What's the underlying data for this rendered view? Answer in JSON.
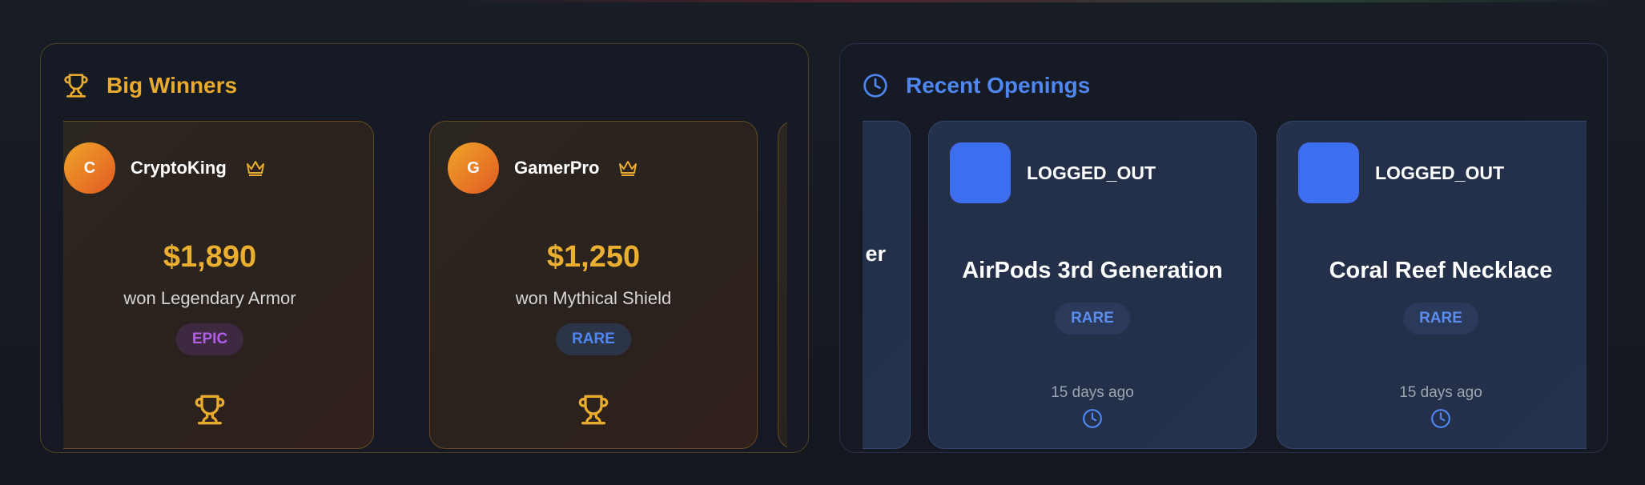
{
  "big_winners": {
    "title": "Big Winners",
    "icon": "trophy-icon",
    "accent": "#e8ab2e",
    "cards": [
      {
        "initial": "C",
        "username": "CryptoKing",
        "amount": "$1,890",
        "won_text": "won Legendary Armor",
        "rarity": "EPIC",
        "rarity_color": "#b35ee8"
      },
      {
        "initial": "G",
        "username": "GamerPro",
        "amount": "$1,250",
        "won_text": "won Mythical Shield",
        "rarity": "RARE",
        "rarity_color": "#4f86f0"
      }
    ]
  },
  "recent_openings": {
    "title": "Recent Openings",
    "icon": "clock-icon",
    "accent": "#4f86f0",
    "partial_card_text": "er",
    "cards": [
      {
        "username": "LOGGED_OUT",
        "item": "AirPods 3rd Generation",
        "rarity": "RARE",
        "time": "15 days ago",
        "thumb_color": "#3d6ef0"
      },
      {
        "username": "LOGGED_OUT",
        "item": "Coral Reef Necklace",
        "rarity": "RARE",
        "time": "15 days ago",
        "thumb_color": "#3d6ef0"
      }
    ]
  }
}
